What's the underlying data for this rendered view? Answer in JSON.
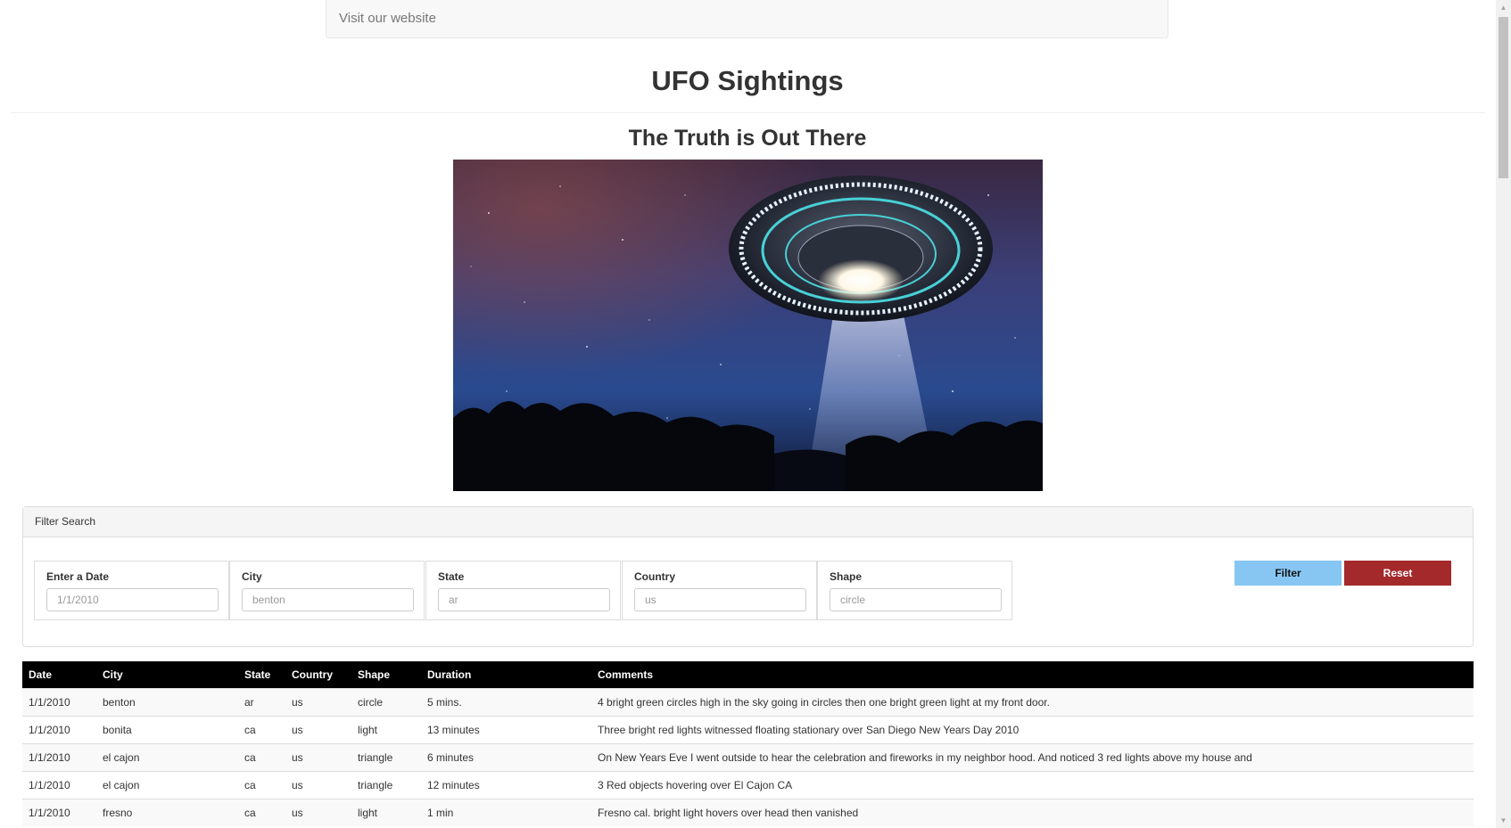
{
  "navbar": {
    "brand": "Visit our website"
  },
  "header": {
    "title": "UFO Sightings",
    "subtitle": "The Truth is Out There"
  },
  "hero": {
    "image": "ufo-over-night-sky"
  },
  "filter_panel": {
    "heading": "Filter Search",
    "fields": [
      {
        "label": "Enter a Date",
        "placeholder": "1/1/2010"
      },
      {
        "label": "City",
        "placeholder": "benton"
      },
      {
        "label": "State",
        "placeholder": "ar"
      },
      {
        "label": "Country",
        "placeholder": "us"
      },
      {
        "label": "Shape",
        "placeholder": "circle"
      }
    ],
    "filter_label": "Filter",
    "reset_label": "Reset",
    "filter_color": "#87c6f2",
    "reset_color": "#a3292b"
  },
  "table": {
    "columns": [
      "Date",
      "City",
      "State",
      "Country",
      "Shape",
      "Duration",
      "Comments"
    ],
    "rows": [
      [
        "1/1/2010",
        "benton",
        "ar",
        "us",
        "circle",
        "5 mins.",
        "4 bright green circles high in the sky going in circles then one bright green light at my front door."
      ],
      [
        "1/1/2010",
        "bonita",
        "ca",
        "us",
        "light",
        "13 minutes",
        "Three bright red lights witnessed floating stationary over San Diego New Years Day 2010"
      ],
      [
        "1/1/2010",
        "el cajon",
        "ca",
        "us",
        "triangle",
        "6 minutes",
        "On New Years Eve I went outside to hear the celebration and fireworks in my neighbor hood. And noticed 3 red lights above my house and"
      ],
      [
        "1/1/2010",
        "el cajon",
        "ca",
        "us",
        "triangle",
        "12 minutes",
        "3 Red objects hovering over El Cajon CA"
      ],
      [
        "1/1/2010",
        "fresno",
        "ca",
        "us",
        "light",
        "1 min",
        "Fresno cal. bright light hovers over head then vanished"
      ]
    ]
  },
  "scrollbar": {
    "up_icon": "arrow-up-icon",
    "down_icon": "arrow-down-icon"
  }
}
